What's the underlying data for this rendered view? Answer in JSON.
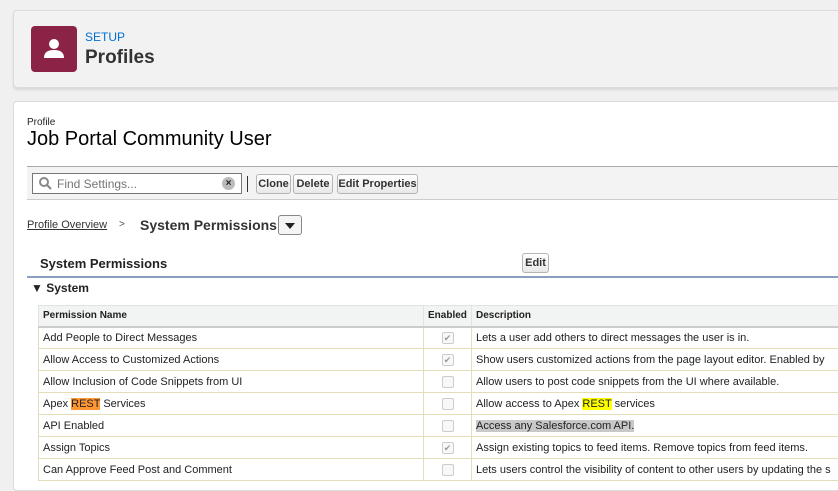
{
  "header": {
    "section": "SETUP",
    "title": "Profiles",
    "icon": "user-icon",
    "icon_color": "#8b2346"
  },
  "profile": {
    "label": "Profile",
    "name": "Job Portal Community User"
  },
  "toolbar": {
    "search_placeholder": "Find Settings...",
    "clone": "Clone",
    "delete": "Delete",
    "edit_properties": "Edit Properties"
  },
  "breadcrumb": {
    "parent": "Profile Overview",
    "separator": ">",
    "current": "System Permissions"
  },
  "section": {
    "title": "System Permissions",
    "edit": "Edit",
    "group": "System"
  },
  "table": {
    "headers": [
      "Permission Name",
      "Enabled",
      "Description"
    ],
    "rows": [
      {
        "name_pre": "Add People to Direct Messages",
        "name_hl": "",
        "name_post": "",
        "enabled": true,
        "desc_pre": "Lets a user add others to direct messages the user is in.",
        "desc_hl": "",
        "desc_post": ""
      },
      {
        "name_pre": "Allow Access to Customized Actions",
        "name_hl": "",
        "name_post": "",
        "enabled": true,
        "desc_pre": "Show users customized actions from the page layout editor. Enabled by",
        "desc_hl": "",
        "desc_post": ""
      },
      {
        "name_pre": "Allow Inclusion of Code Snippets from UI",
        "name_hl": "",
        "name_post": "",
        "enabled": false,
        "desc_pre": "Allow users to post code snippets from the UI where available.",
        "desc_hl": "",
        "desc_post": ""
      },
      {
        "name_pre": "Apex ",
        "name_hl": "REST",
        "name_post": " Services",
        "enabled": false,
        "desc_pre": "Allow access to Apex ",
        "desc_hl": "REST",
        "desc_post": " services"
      },
      {
        "name_pre": "API Enabled",
        "name_hl": "",
        "name_post": "",
        "enabled": false,
        "desc_pre": "",
        "desc_sel": "Access any Salesforce.com API.",
        "desc_hl": "",
        "desc_post": ""
      },
      {
        "name_pre": "Assign Topics",
        "name_hl": "",
        "name_post": "",
        "enabled": true,
        "desc_pre": "Assign existing topics to feed items. Remove topics from feed items.",
        "desc_hl": "",
        "desc_post": ""
      },
      {
        "name_pre": "Can Approve Feed Post and Comment",
        "name_hl": "",
        "name_post": "",
        "enabled": false,
        "desc_pre": "Lets users control the visibility of content to other users by updating the s",
        "desc_hl": "",
        "desc_post": ""
      }
    ]
  }
}
